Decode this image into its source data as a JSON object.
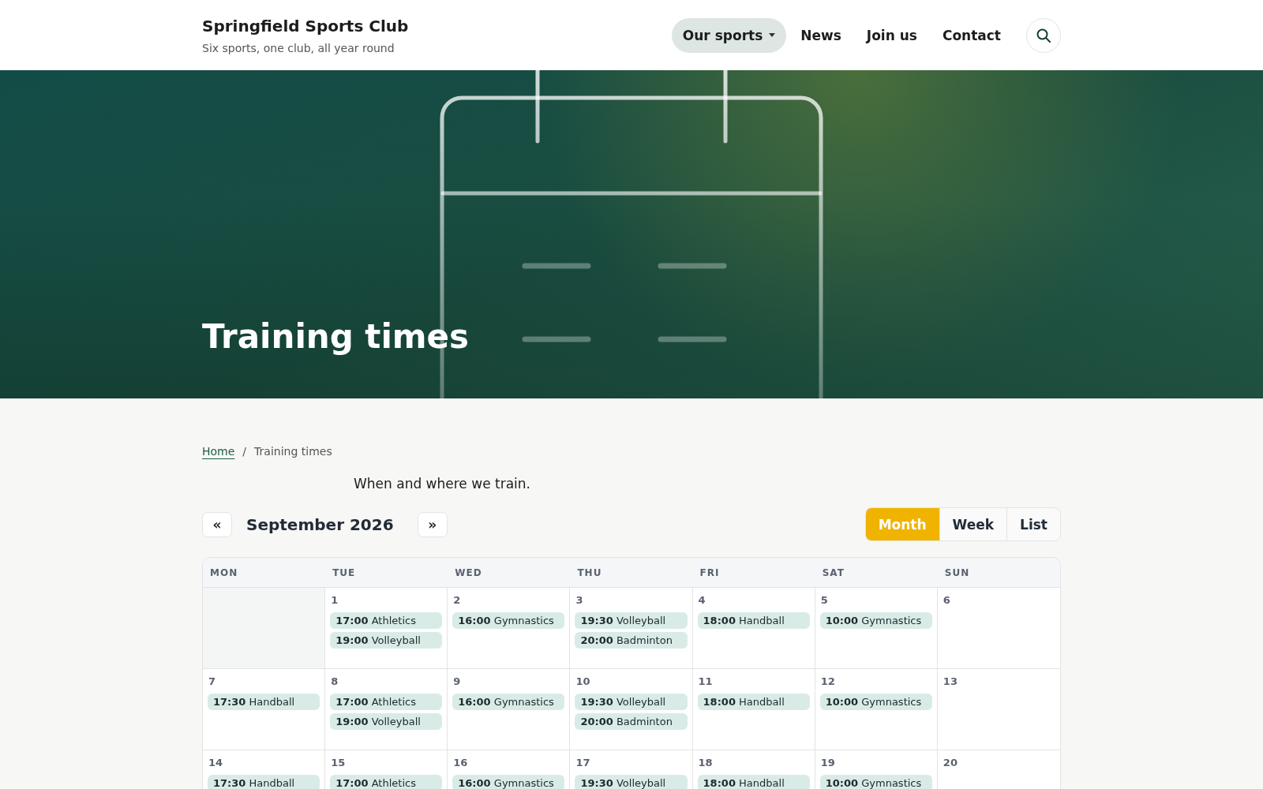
{
  "header": {
    "title": "Springfield Sports Club",
    "tagline": "Six sports, one club, all year round",
    "nav": [
      {
        "label": "Our sports",
        "kind": "dropdown",
        "selected": true
      },
      {
        "label": "News",
        "kind": "link",
        "selected": false
      },
      {
        "label": "Join us",
        "kind": "link",
        "selected": false
      },
      {
        "label": "Contact",
        "kind": "link",
        "selected": false
      }
    ]
  },
  "hero": {
    "title": "Training times"
  },
  "breadcrumb": [
    {
      "label": "Home",
      "kind": "link"
    },
    {
      "label": "/",
      "kind": "separator"
    },
    {
      "label": "Training times",
      "kind": "current"
    }
  ],
  "intro": "When and where we train.",
  "calendar": {
    "prev": "«",
    "next": "»",
    "month": "September 2026",
    "views": [
      {
        "label": "Month",
        "selected": true
      },
      {
        "label": "Week",
        "selected": false
      },
      {
        "label": "List",
        "selected": false
      }
    ],
    "weekdays": [
      "MON",
      "TUE",
      "WED",
      "THU",
      "FRI",
      "SAT",
      "SUN"
    ],
    "weeks": [
      [
        {
          "kind": "blank"
        },
        {
          "kind": "day",
          "number": "1",
          "events": [
            {
              "time": "17:00",
              "name": "Athletics"
            },
            {
              "time": "19:00",
              "name": "Volleyball"
            }
          ]
        },
        {
          "kind": "day",
          "number": "2",
          "events": [
            {
              "time": "16:00",
              "name": "Gymnastics"
            }
          ]
        },
        {
          "kind": "day",
          "number": "3",
          "events": [
            {
              "time": "19:30",
              "name": "Volleyball"
            },
            {
              "time": "20:00",
              "name": "Badminton"
            }
          ]
        },
        {
          "kind": "day",
          "number": "4",
          "events": [
            {
              "time": "18:00",
              "name": "Handball"
            }
          ]
        },
        {
          "kind": "day",
          "number": "5",
          "events": [
            {
              "time": "10:00",
              "name": "Gymnastics"
            }
          ]
        },
        {
          "kind": "day",
          "number": "6"
        }
      ],
      [
        {
          "kind": "day",
          "number": "7",
          "events": [
            {
              "time": "17:30",
              "name": "Handball"
            }
          ]
        },
        {
          "kind": "day",
          "number": "8",
          "events": [
            {
              "time": "17:00",
              "name": "Athletics"
            },
            {
              "time": "19:00",
              "name": "Volleyball"
            }
          ]
        },
        {
          "kind": "day",
          "number": "9",
          "events": [
            {
              "time": "16:00",
              "name": "Gymnastics"
            }
          ]
        },
        {
          "kind": "day",
          "number": "10",
          "events": [
            {
              "time": "19:30",
              "name": "Volleyball"
            },
            {
              "time": "20:00",
              "name": "Badminton"
            }
          ]
        },
        {
          "kind": "day",
          "number": "11",
          "events": [
            {
              "time": "18:00",
              "name": "Handball"
            }
          ]
        },
        {
          "kind": "day",
          "number": "12",
          "events": [
            {
              "time": "10:00",
              "name": "Gymnastics"
            }
          ]
        },
        {
          "kind": "day",
          "number": "13"
        }
      ],
      [
        {
          "kind": "day",
          "number": "14",
          "events": [
            {
              "time": "17:30",
              "name": "Handball"
            }
          ]
        },
        {
          "kind": "day",
          "number": "15",
          "events": [
            {
              "time": "17:00",
              "name": "Athletics"
            }
          ]
        },
        {
          "kind": "day",
          "number": "16",
          "events": [
            {
              "time": "16:00",
              "name": "Gymnastics"
            }
          ]
        },
        {
          "kind": "day",
          "number": "17",
          "events": [
            {
              "time": "19:30",
              "name": "Volleyball"
            }
          ]
        },
        {
          "kind": "day",
          "number": "18",
          "events": [
            {
              "time": "18:00",
              "name": "Handball"
            }
          ]
        },
        {
          "kind": "day",
          "number": "19",
          "events": [
            {
              "time": "10:00",
              "name": "Gymnastics"
            }
          ]
        },
        {
          "kind": "day",
          "number": "20"
        }
      ]
    ]
  }
}
